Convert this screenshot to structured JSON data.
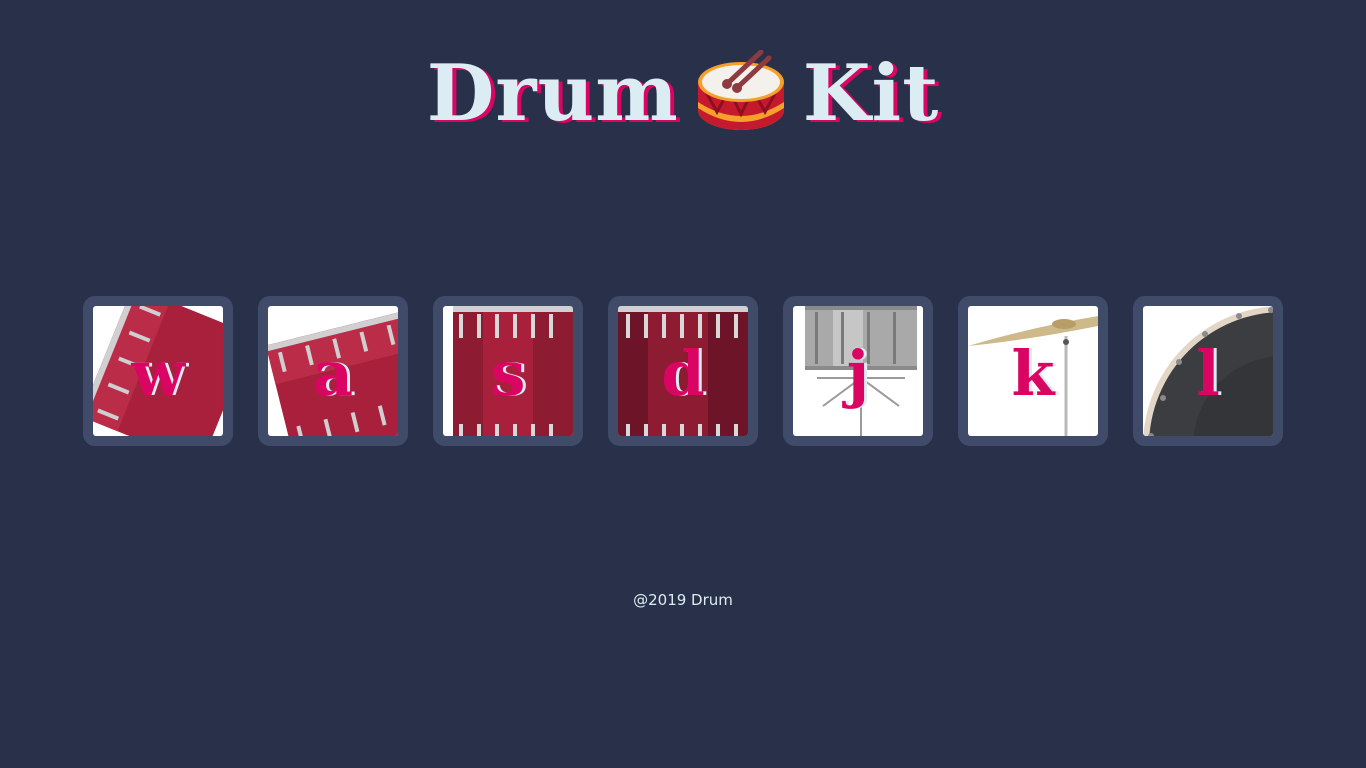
{
  "header": {
    "title_left": "Drum",
    "title_icon": "drum-emoji-icon",
    "title_right": "Kit"
  },
  "drum_keys": [
    {
      "key": "w",
      "instrument_icon": "crash-drum-icon"
    },
    {
      "key": "a",
      "instrument_icon": "kick-drum-icon"
    },
    {
      "key": "s",
      "instrument_icon": "tom-drum-icon"
    },
    {
      "key": "d",
      "instrument_icon": "floor-tom-icon"
    },
    {
      "key": "j",
      "instrument_icon": "snare-drum-icon"
    },
    {
      "key": "k",
      "instrument_icon": "cymbal-icon"
    },
    {
      "key": "l",
      "instrument_icon": "bass-drum-icon"
    }
  ],
  "footer": {
    "copyright": "@2019 Drum"
  },
  "colors": {
    "background": "#283149",
    "key_frame": "#404b69",
    "accent": "#da0463",
    "light_text": "#dbedf3"
  }
}
